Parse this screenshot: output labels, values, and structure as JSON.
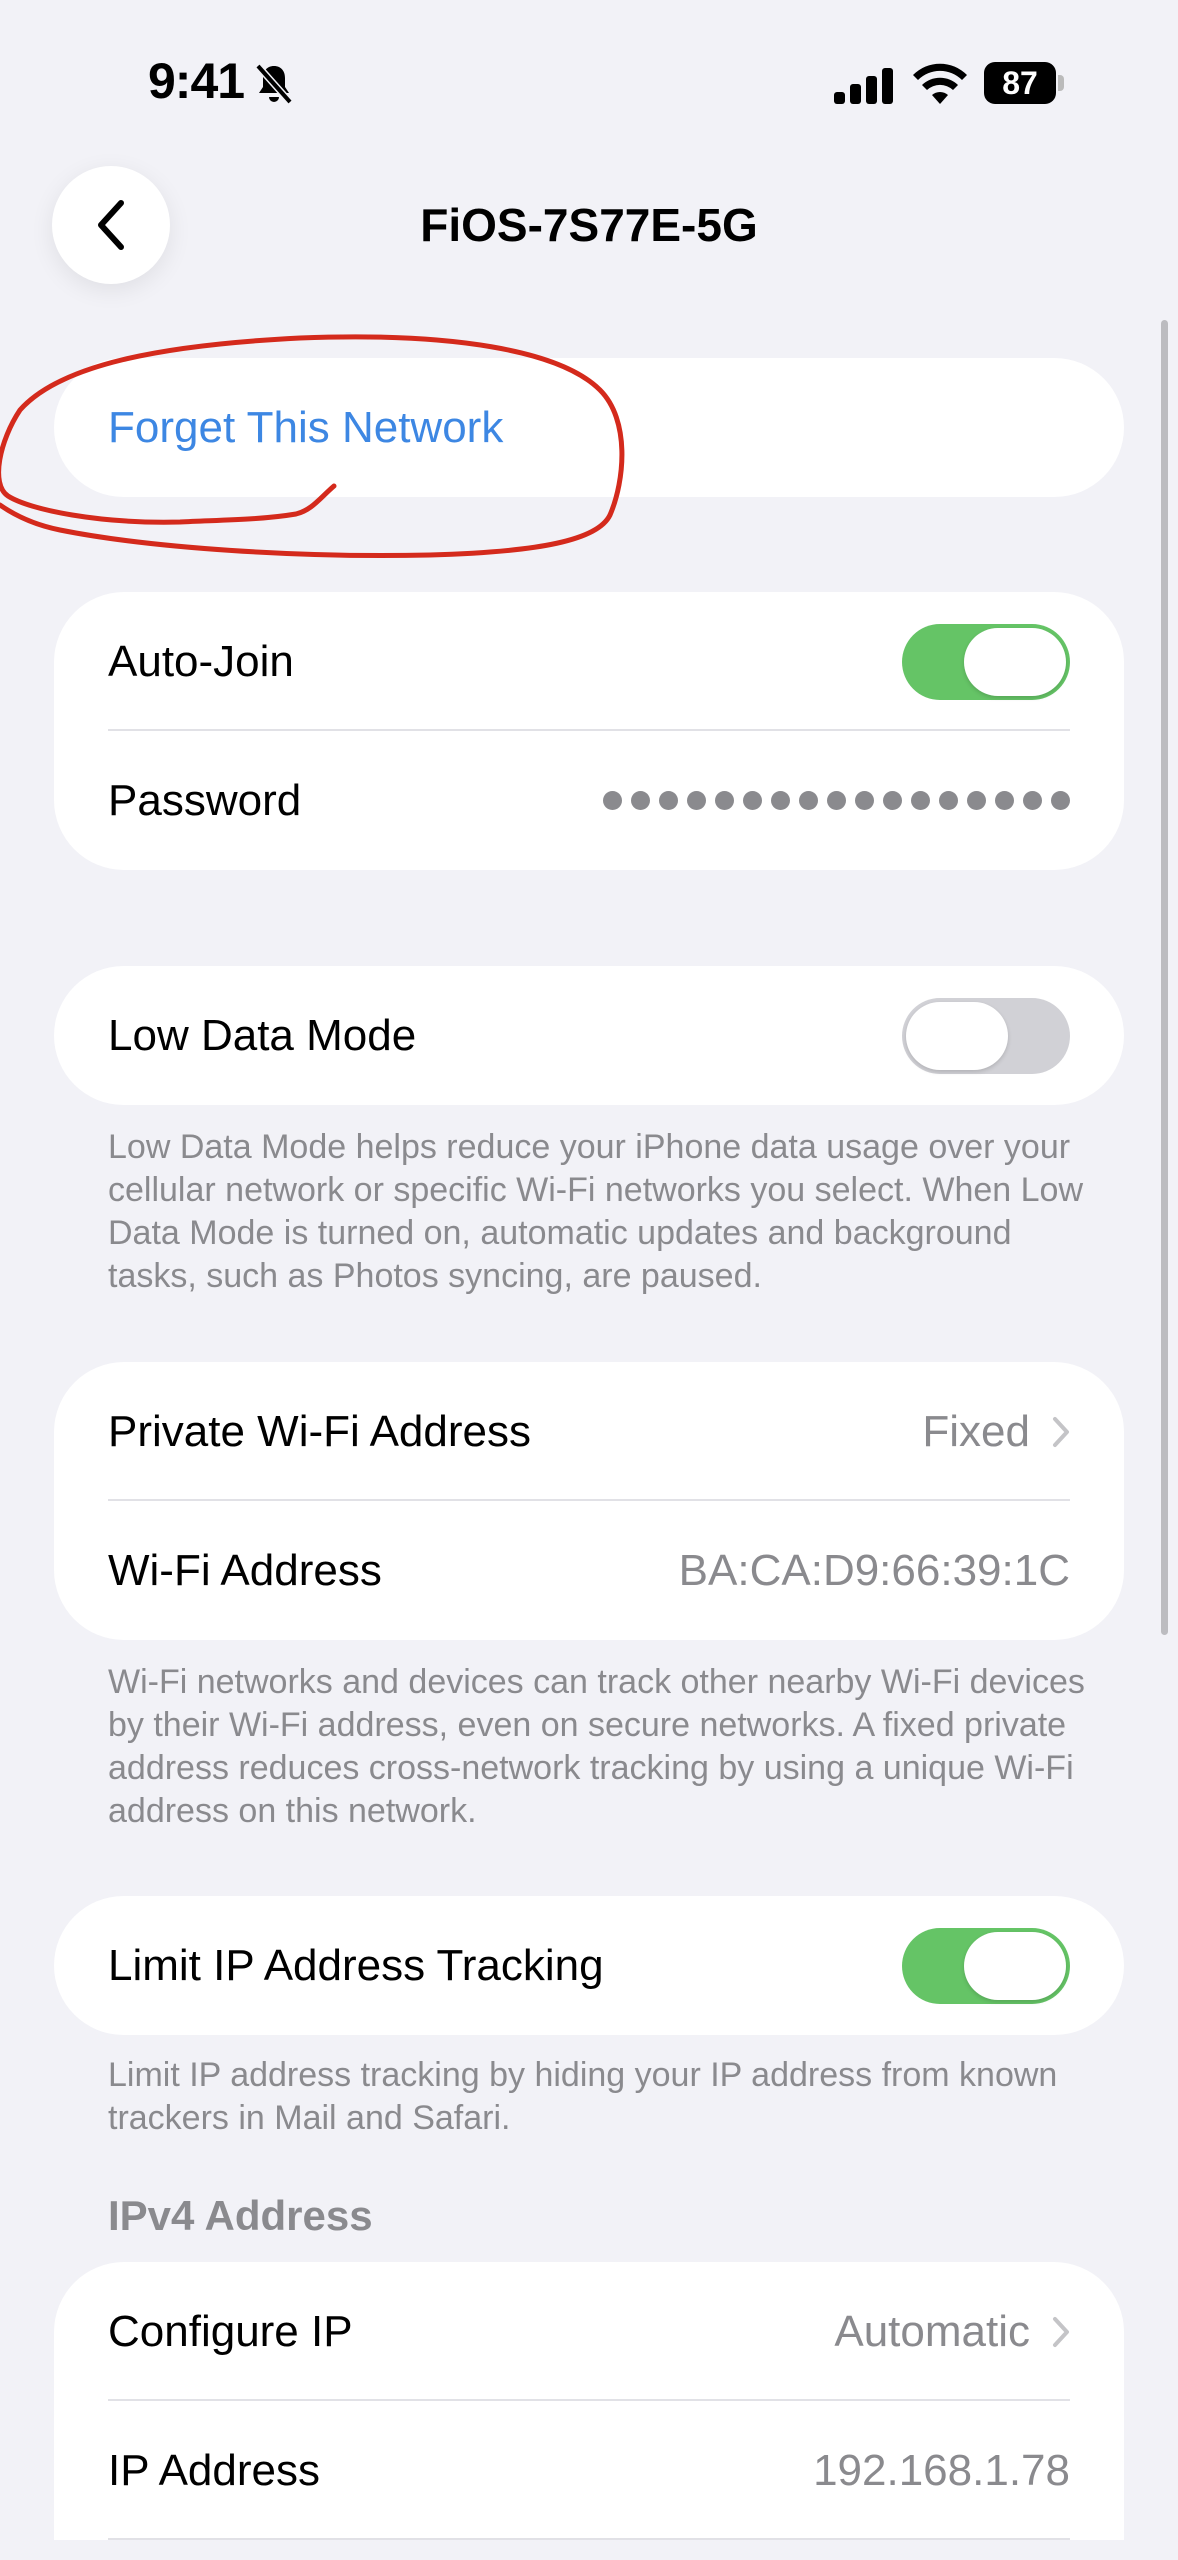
{
  "status_bar": {
    "time": "9:41",
    "battery": "87"
  },
  "nav": {
    "title": "FiOS-7S77E-5G",
    "back_icon": "chevron-left-icon"
  },
  "forget": {
    "label": "Forget This Network"
  },
  "group1": {
    "auto_join": {
      "label": "Auto-Join",
      "enabled": true
    },
    "password": {
      "label": "Password",
      "masked_dot_count": 17
    }
  },
  "low_data": {
    "label": "Low Data Mode",
    "enabled": false,
    "footnote": "Low Data Mode helps reduce your iPhone data usage over your cellular network or specific Wi-Fi networks you select. When Low Data Mode is turned on, automatic updates and background tasks, such as Photos syncing, are paused."
  },
  "address_group": {
    "private_address": {
      "label": "Private Wi-Fi Address",
      "value": "Fixed"
    },
    "wifi_address": {
      "label": "Wi-Fi Address",
      "value": "BA:CA:D9:66:39:1C"
    },
    "footnote": "Wi-Fi networks and devices can track other nearby Wi-Fi devices by their Wi-Fi address, even on secure networks. A fixed private address reduces cross-network tracking by using a unique Wi-Fi address on this network."
  },
  "limit_ip": {
    "label": "Limit IP Address Tracking",
    "enabled": true,
    "footnote": "Limit IP address tracking by hiding your IP address from known trackers in Mail and Safari."
  },
  "ipv4": {
    "header": "IPv4 Address",
    "configure": {
      "label": "Configure IP",
      "value": "Automatic"
    },
    "ip_address": {
      "label": "IP Address",
      "value": "192.168.1.78"
    }
  },
  "colors": {
    "accent_blue": "#3d87e3",
    "toggle_on": "#65c466",
    "annotation_red": "#d42a1c",
    "background": "#f2f2f7"
  }
}
